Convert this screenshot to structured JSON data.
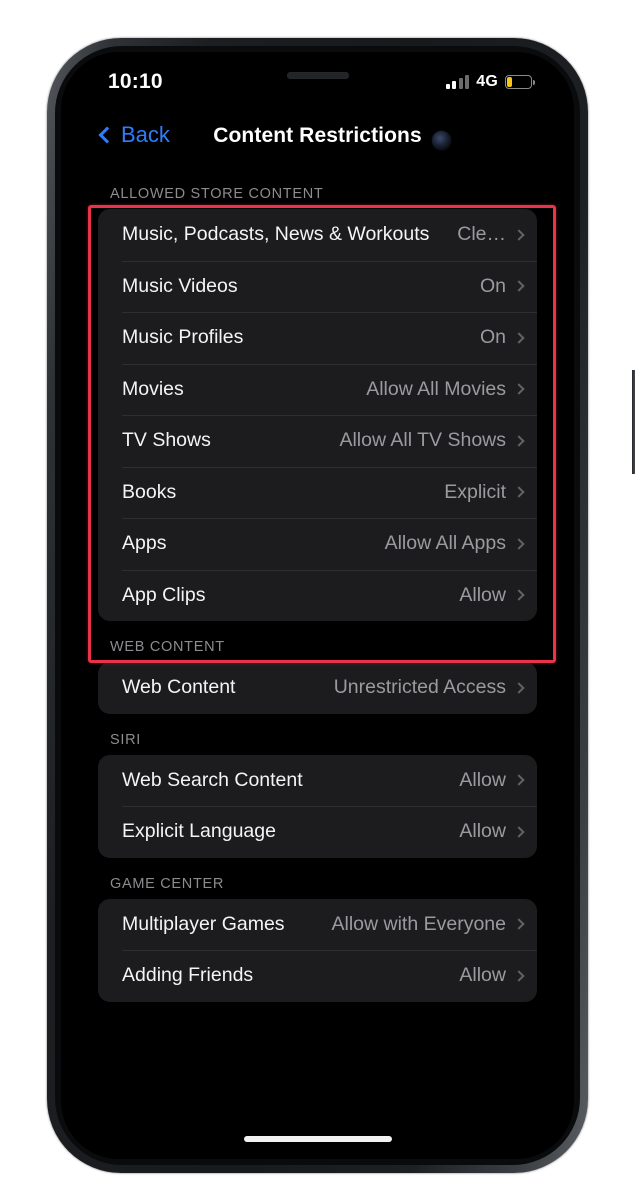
{
  "status_bar": {
    "time": "10:10",
    "network": "4G",
    "signal_bars_filled": 2,
    "signal_bars_total": 4,
    "battery_level_percent": 22,
    "battery_color": "#f5c518"
  },
  "nav": {
    "back_label": "Back",
    "title": "Content Restrictions",
    "accent_color": "#2f7dfb"
  },
  "sections": [
    {
      "header": "ALLOWED STORE CONTENT",
      "rows": [
        {
          "label": "Music, Podcasts, News & Workouts",
          "value": "Cle…"
        },
        {
          "label": "Music Videos",
          "value": "On"
        },
        {
          "label": "Music Profiles",
          "value": "On"
        },
        {
          "label": "Movies",
          "value": "Allow All Movies"
        },
        {
          "label": "TV Shows",
          "value": "Allow All TV Shows"
        },
        {
          "label": "Books",
          "value": "Explicit"
        },
        {
          "label": "Apps",
          "value": "Allow All Apps"
        },
        {
          "label": "App Clips",
          "value": "Allow"
        }
      ]
    },
    {
      "header": "WEB CONTENT",
      "rows": [
        {
          "label": "Web Content",
          "value": "Unrestricted Access"
        }
      ]
    },
    {
      "header": "SIRI",
      "rows": [
        {
          "label": "Web Search Content",
          "value": "Allow"
        },
        {
          "label": "Explicit Language",
          "value": "Allow"
        }
      ]
    },
    {
      "header": "GAME CENTER",
      "rows": [
        {
          "label": "Multiplayer Games",
          "value": "Allow with Everyone"
        },
        {
          "label": "Adding Friends",
          "value": "Allow"
        }
      ]
    }
  ],
  "annotation": {
    "color": "#e8334a",
    "target_section": "ALLOWED STORE CONTENT"
  }
}
